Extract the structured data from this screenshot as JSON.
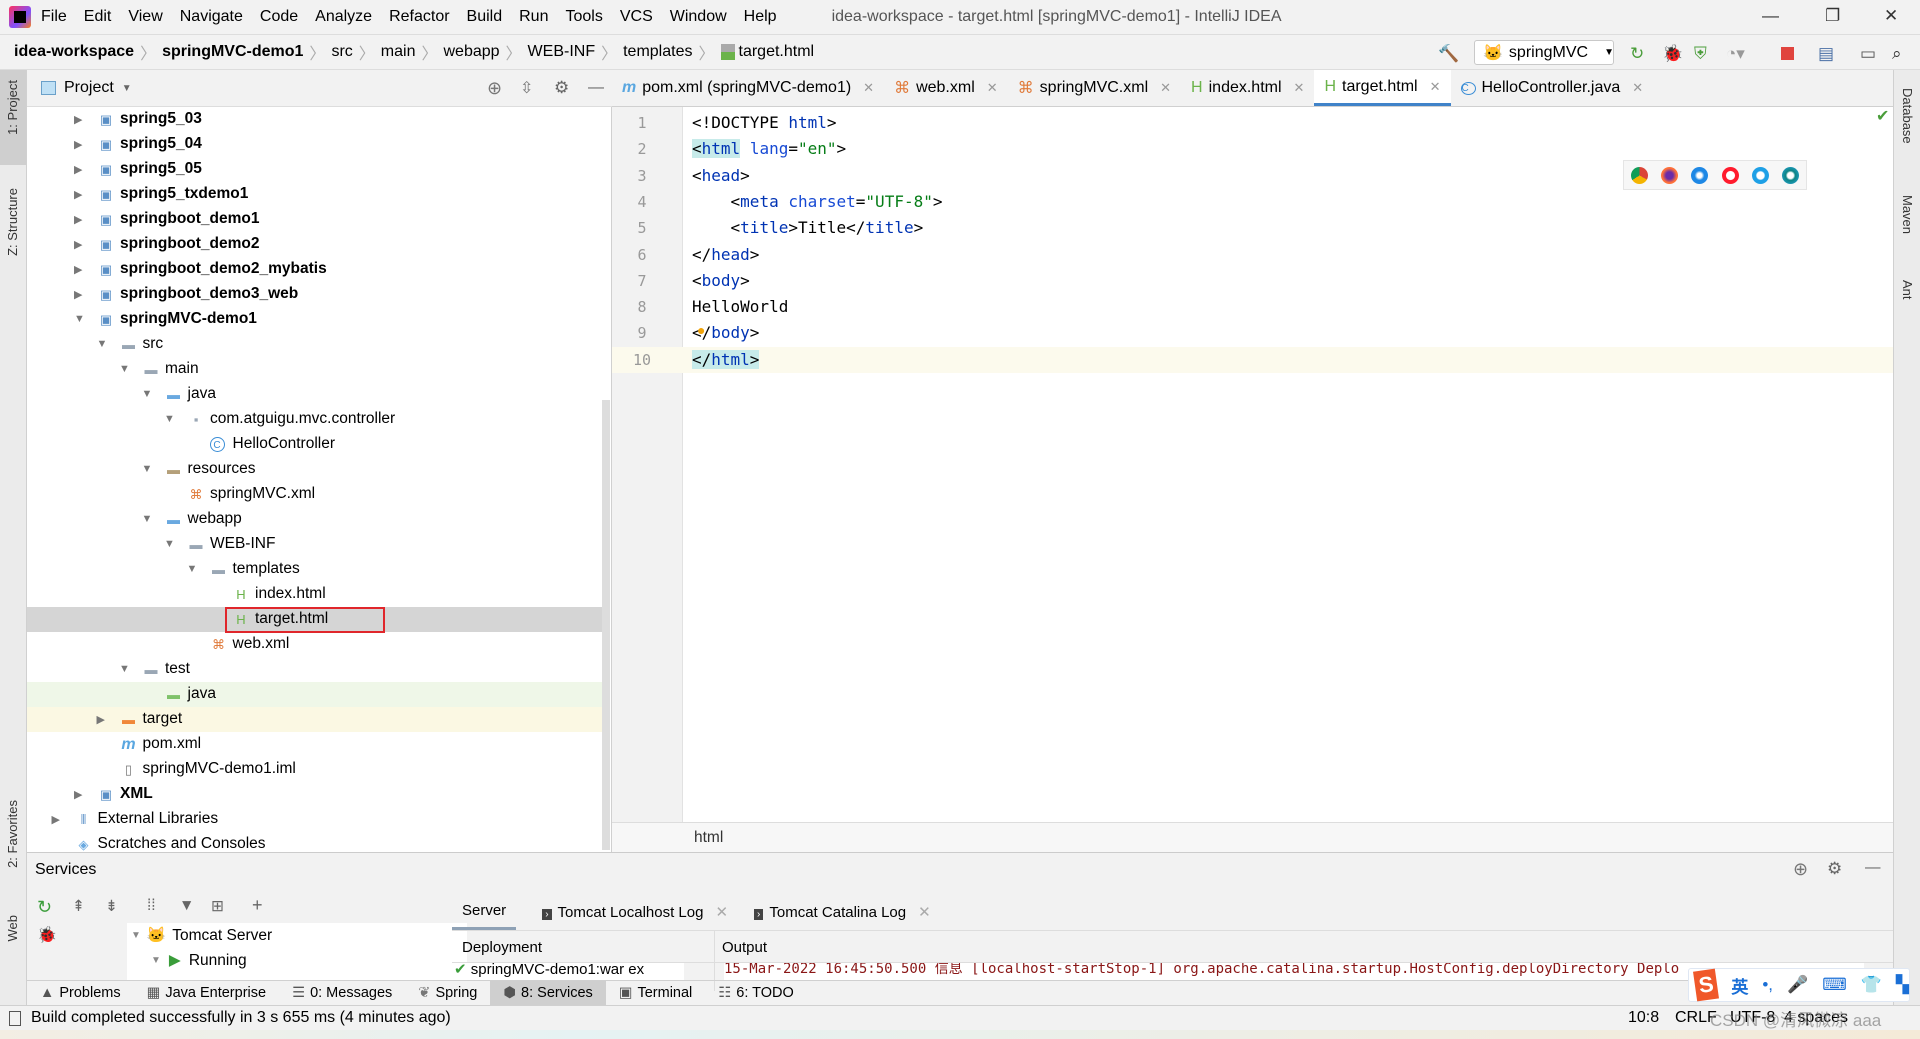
{
  "window": {
    "title": "idea-workspace - target.html [springMVC-demo1] - IntelliJ IDEA",
    "menu": [
      "File",
      "Edit",
      "View",
      "Navigate",
      "Code",
      "Analyze",
      "Refactor",
      "Build",
      "Run",
      "Tools",
      "VCS",
      "Window",
      "Help"
    ],
    "controls": {
      "minimize": "—",
      "restore": "❐",
      "close": "✕"
    }
  },
  "breadcrumb": [
    "idea-workspace",
    "springMVC-demo1",
    "src",
    "main",
    "webapp",
    "WEB-INF",
    "templates",
    "target.html"
  ],
  "run_config": "springMVC",
  "left_stripe": [
    "1: Project",
    "Z: Structure",
    "2: Favorites",
    "Web"
  ],
  "right_stripe": [
    "Database",
    "Maven",
    "Ant"
  ],
  "project": {
    "title": "Project",
    "tree": [
      {
        "label": "spring5_03",
        "depth": 0,
        "arrow": "closed",
        "icon": "module",
        "bold": true
      },
      {
        "label": "spring5_04",
        "depth": 0,
        "arrow": "closed",
        "icon": "module",
        "bold": true
      },
      {
        "label": "spring5_05",
        "depth": 0,
        "arrow": "closed",
        "icon": "module",
        "bold": true
      },
      {
        "label": "spring5_txdemo1",
        "depth": 0,
        "arrow": "closed",
        "icon": "module",
        "bold": true
      },
      {
        "label": "springboot_demo1",
        "depth": 0,
        "arrow": "closed",
        "icon": "module",
        "bold": true
      },
      {
        "label": "springboot_demo2",
        "depth": 0,
        "arrow": "closed",
        "icon": "module",
        "bold": true
      },
      {
        "label": "springboot_demo2_mybatis",
        "depth": 0,
        "arrow": "closed",
        "icon": "module",
        "bold": true
      },
      {
        "label": "springboot_demo3_web",
        "depth": 0,
        "arrow": "closed",
        "icon": "module",
        "bold": true
      },
      {
        "label": "springMVC-demo1",
        "depth": 0,
        "arrow": "open",
        "icon": "module",
        "bold": true
      },
      {
        "label": "src",
        "depth": 1,
        "arrow": "open",
        "icon": "folder"
      },
      {
        "label": "main",
        "depth": 2,
        "arrow": "open",
        "icon": "folder"
      },
      {
        "label": "java",
        "depth": 3,
        "arrow": "open",
        "icon": "source-folder"
      },
      {
        "label": "com.atguigu.mvc.controller",
        "depth": 4,
        "arrow": "open",
        "icon": "package"
      },
      {
        "label": "HelloController",
        "depth": 5,
        "icon": "class"
      },
      {
        "label": "resources",
        "depth": 3,
        "arrow": "open",
        "icon": "resources-folder"
      },
      {
        "label": "springMVC.xml",
        "depth": 4,
        "icon": "xml"
      },
      {
        "label": "webapp",
        "depth": 3,
        "arrow": "open",
        "icon": "web-folder"
      },
      {
        "label": "WEB-INF",
        "depth": 4,
        "arrow": "open",
        "icon": "folder"
      },
      {
        "label": "templates",
        "depth": 5,
        "arrow": "open",
        "icon": "folder"
      },
      {
        "label": "index.html",
        "depth": 6,
        "icon": "html"
      },
      {
        "label": "target.html",
        "depth": 6,
        "icon": "html",
        "selected": true
      },
      {
        "label": "web.xml",
        "depth": 5,
        "icon": "xml"
      },
      {
        "label": "test",
        "depth": 2,
        "arrow": "open",
        "icon": "folder"
      },
      {
        "label": "java",
        "depth": 3,
        "icon": "test-folder",
        "highlight": "test"
      },
      {
        "label": "target",
        "depth": 1,
        "arrow": "closed",
        "icon": "excluded-folder",
        "highlight": "excl"
      },
      {
        "label": "pom.xml",
        "depth": 1,
        "icon": "maven"
      },
      {
        "label": "springMVC-demo1.iml",
        "depth": 1,
        "icon": "iml"
      },
      {
        "label": "XML",
        "depth": 0,
        "arrow": "closed",
        "icon": "module",
        "bold": true
      },
      {
        "label": "External Libraries",
        "depth": -1,
        "arrow": "closed",
        "icon": "libraries"
      },
      {
        "label": "Scratches and Consoles",
        "depth": -1,
        "icon": "scratches"
      }
    ]
  },
  "editor": {
    "tabs": [
      {
        "label": "pom.xml (springMVC-demo1)",
        "icon": "maven"
      },
      {
        "label": "web.xml",
        "icon": "xml"
      },
      {
        "label": "springMVC.xml",
        "icon": "xml"
      },
      {
        "label": "index.html",
        "icon": "html"
      },
      {
        "label": "target.html",
        "icon": "html",
        "active": true
      },
      {
        "label": "HelloController.java",
        "icon": "class"
      }
    ],
    "current_line": 10,
    "lines": [
      [
        [
          "punc",
          "<!DOCTYPE "
        ],
        [
          "name",
          "html"
        ],
        [
          "punc",
          ">"
        ]
      ],
      [
        [
          "punc",
          "<"
        ],
        [
          "name",
          "html"
        ],
        [
          "txt",
          " "
        ],
        [
          "attr",
          "lang"
        ],
        [
          "punc",
          "="
        ],
        [
          "str",
          "\"en\""
        ],
        [
          "punc",
          ">"
        ]
      ],
      [
        [
          "punc",
          "<"
        ],
        [
          "name",
          "head"
        ],
        [
          "punc",
          ">"
        ]
      ],
      [
        [
          "txt",
          "    "
        ],
        [
          "punc",
          "<"
        ],
        [
          "name",
          "meta"
        ],
        [
          "txt",
          " "
        ],
        [
          "attr",
          "charset"
        ],
        [
          "punc",
          "="
        ],
        [
          "str",
          "\"UTF-8\""
        ],
        [
          "punc",
          ">"
        ]
      ],
      [
        [
          "txt",
          "    "
        ],
        [
          "punc",
          "<"
        ],
        [
          "name",
          "title"
        ],
        [
          "punc",
          ">"
        ],
        [
          "txt",
          "Title"
        ],
        [
          "punc",
          "</"
        ],
        [
          "name",
          "title"
        ],
        [
          "punc",
          ">"
        ]
      ],
      [
        [
          "punc",
          "</"
        ],
        [
          "name",
          "head"
        ],
        [
          "punc",
          ">"
        ]
      ],
      [
        [
          "punc",
          "<"
        ],
        [
          "name",
          "body"
        ],
        [
          "punc",
          ">"
        ]
      ],
      [
        [
          "txt",
          "HelloWorld"
        ]
      ],
      [
        [
          "punc",
          "</"
        ],
        [
          "name",
          "body"
        ],
        [
          "punc",
          ">"
        ]
      ],
      [
        [
          "punc",
          "</"
        ],
        [
          "name",
          "html"
        ],
        [
          "punc",
          ">"
        ]
      ]
    ],
    "breadcrumb": "html",
    "browsers": [
      "chrome",
      "firefox",
      "safari",
      "opera",
      "ie",
      "edge"
    ]
  },
  "services": {
    "title": "Services",
    "tree": [
      "Tomcat Server",
      "Running"
    ],
    "tabs": [
      "Server",
      "Tomcat Localhost Log",
      "Tomcat Catalina Log"
    ],
    "deployment_header": "Deployment",
    "output_header": "Output",
    "deployment_item": "springMVC-demo1:war ex",
    "output_line": "15-Mar-2022 16:45:50.500 信息 [localhost-startStop-1] org.apache.catalina.startup.HostConfig.deployDirectory Deplo"
  },
  "tool_windows": [
    "Problems",
    "Java Enterprise",
    "0: Messages",
    "Spring",
    "8: Services",
    "Terminal",
    "6: TODO"
  ],
  "status": {
    "message": "Build completed successfully in 3 s 655 ms (4 minutes ago)",
    "position": "10:8",
    "line_sep": "CRLF",
    "encoding": "UTF-8",
    "indent": "4 spaces"
  },
  "ime": {
    "lang": "英",
    "punct": "•,"
  },
  "watermark": "CSDN @清风微凉 aaa"
}
